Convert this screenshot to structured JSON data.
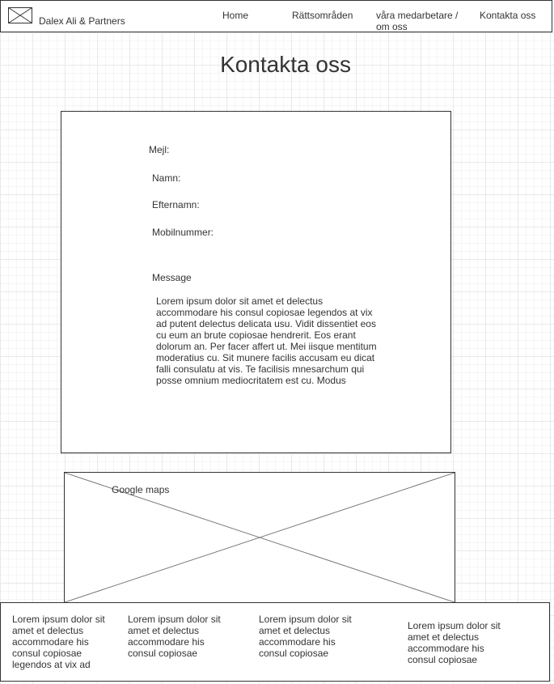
{
  "header": {
    "brand": "Dalex Ali & Partners",
    "logo_icon": "image-placeholder-icon",
    "nav": {
      "home": "Home",
      "rattsomraden": "Rättsområden",
      "vara_medarbetare": "våra medarbetare / om oss",
      "kontakta_oss": "Kontakta oss"
    }
  },
  "page": {
    "title": "Kontakta oss"
  },
  "form": {
    "email_label": "Mejl:",
    "first_name_label": "Namn:",
    "last_name_label": "Efternamn:",
    "mobile_label": "Mobilnummer:",
    "message_label": "Message",
    "message_text": "Lorem ipsum dolor sit amet et delectus accommodare his consul copiosae legendos at vix ad putent delectus delicata usu. Vidit dissentiet eos cu eum an brute copiosae hendrerit. Eos erant dolorum an. Per facer affert ut. Mei iisque mentitum moderatius cu. Sit munere facilis accusam eu dicat falli consulatu at vis. Te facilisis mnesarchum qui posse omnium mediocritatem est cu. Modus"
  },
  "map": {
    "label": "Google maps",
    "icon": "map-placeholder-icon"
  },
  "footer": {
    "columns": [
      "Lorem ipsum dolor sit amet et delectus accommodare his consul copiosae legendos at vix ad",
      "Lorem ipsum dolor sit amet et delectus accommodare his consul copiosae",
      "Lorem ipsum dolor sit amet et delectus accommodare his consul copiosae",
      "Lorem ipsum dolor sit amet et delectus accommodare his consul copiosae"
    ]
  }
}
